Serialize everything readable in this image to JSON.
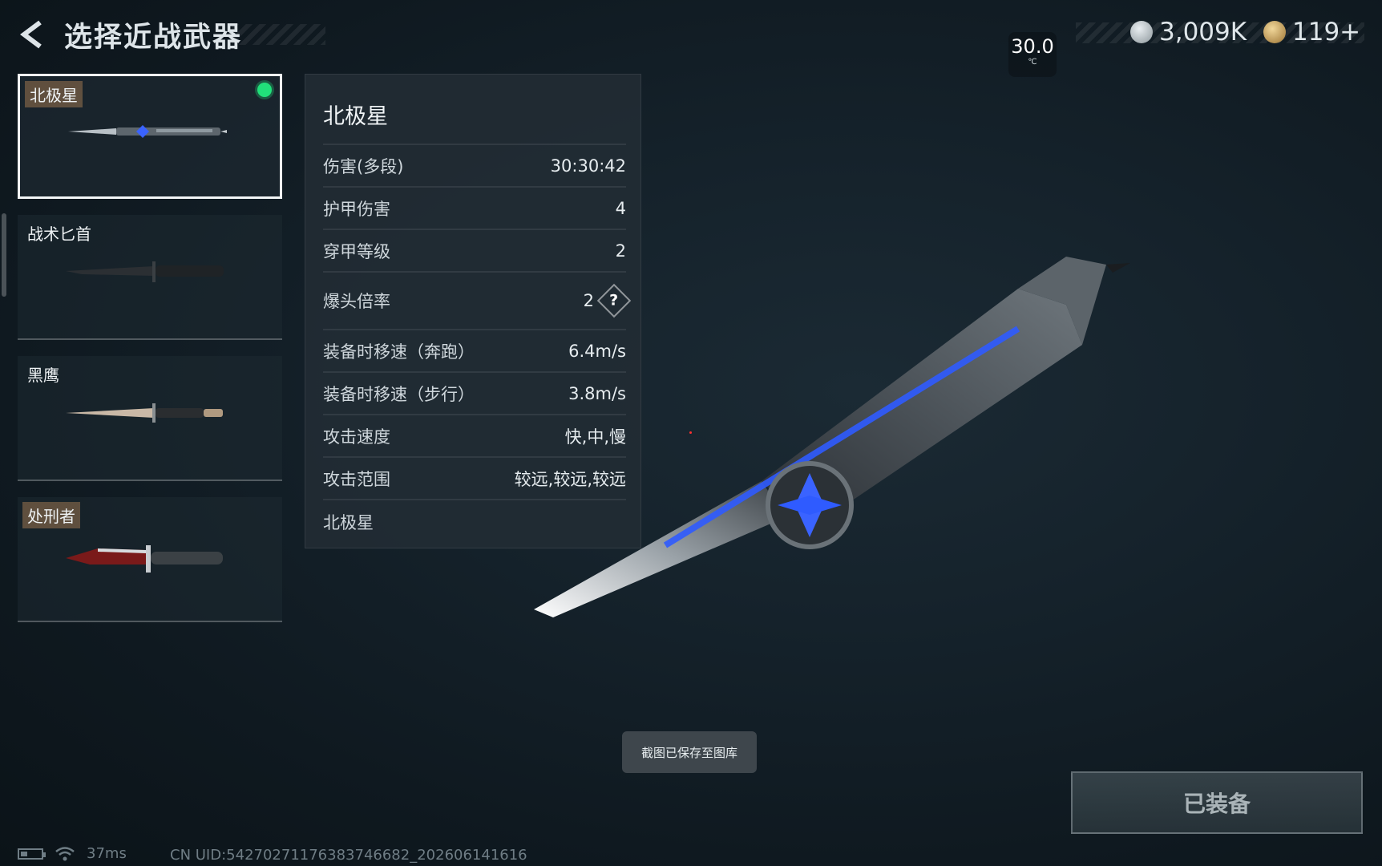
{
  "header": {
    "title": "选择近战武器"
  },
  "currency": {
    "silver": {
      "value": "3,009K",
      "color": "#b9c3c8"
    },
    "gold": {
      "value": "119+",
      "color": "#c9a25a"
    }
  },
  "temperature": {
    "value": "30.0",
    "unit": "℃"
  },
  "weapons": [
    {
      "name": "北极星",
      "selected": true,
      "equipped": true
    },
    {
      "name": "战术匕首"
    },
    {
      "name": "黑鹰"
    },
    {
      "name": "处刑者"
    }
  ],
  "stats": {
    "title": "北极星",
    "rows": [
      {
        "label": "伤害(多段)",
        "value": "30:30:42"
      },
      {
        "label": "护甲伤害",
        "value": "4"
      },
      {
        "label": "穿甲等级",
        "value": "2"
      },
      {
        "label": "爆头倍率",
        "value": "2",
        "help": "?"
      },
      {
        "label": "装备时移速（奔跑）",
        "value": "6.4m/s"
      },
      {
        "label": "装备时移速（步行）",
        "value": "3.8m/s"
      },
      {
        "label": "攻击速度",
        "value": "快,中,慢"
      },
      {
        "label": "攻击范围",
        "value": "较远,较远,较远"
      }
    ],
    "footer": "北极星"
  },
  "toast": "截图已保存至图库",
  "equip_button": "已装备",
  "status": {
    "ping": "37ms",
    "uid": "CN UID:542702711763837466​82_202606141616"
  },
  "colors": {
    "equipped_dot": "#21e07a",
    "accent_blue": "#2f5bff"
  }
}
